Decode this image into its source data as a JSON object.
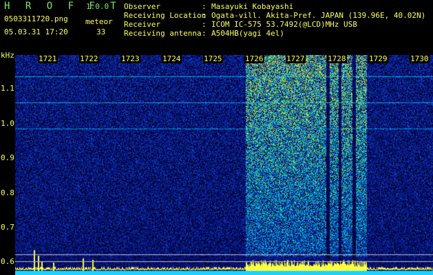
{
  "header": {
    "app_title": "H R O F F T",
    "app_version": "1.0.0",
    "filename": "0503311720.png",
    "datetime": "05.03.31 17:20",
    "meteor_label": "meteor",
    "meteor_count": "33",
    "observer_label": "Observer",
    "observer_value": "Masayuki Kobayashi",
    "location_label": "Receiving Location",
    "location_value": "Ogata-vill. Akita-Pref. JAPAN (139.96E, 40.02N)",
    "receiver_label": "Receiver",
    "receiver_value": "ICOM IC-575 53.7492(@LCD)MHz USB",
    "antenna_label": "Receiving antenna",
    "antenna_value": "A504HB(yagi 4el)",
    "separator": ":"
  },
  "spectrogram": {
    "y_unit": "kHz",
    "y_ticks": [
      "1.1",
      "1.0",
      "0.9",
      "0.8",
      "0.7",
      "0.6"
    ],
    "x_ticks": [
      "1721",
      "1722",
      "1723",
      "1724",
      "1725",
      "1726",
      "1727",
      "1728",
      "1729",
      "1730"
    ],
    "colors": {
      "label": "#ffff60",
      "title": "#7fe86a",
      "background_noise": "#0a1a80",
      "strong_signal": "#ffff40",
      "carrier_line": "#20d0ff"
    }
  }
}
